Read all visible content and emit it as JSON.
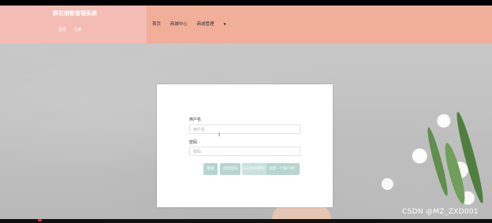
{
  "site": {
    "title": "鲜花销售管理系统",
    "login_label": "登录",
    "register_label": "注册"
  },
  "nav": {
    "items": [
      {
        "label": "首页"
      },
      {
        "label": "商城中心"
      },
      {
        "label": "商城管理"
      }
    ]
  },
  "login": {
    "username_label": "用户名",
    "username_placeholder": "用户名",
    "password_label": "密码",
    "password_placeholder": "密码",
    "login_button": "登录",
    "reset_button": "找回密码",
    "forgot_password": "忘记你的密码？",
    "create_account": "创建一个账户吧！"
  },
  "watermark": "CSDN @MZ_ZXD001",
  "colors": {
    "header_left": "#f3bcb4",
    "header_right": "#f1ae99",
    "button": "#b5d6d0"
  }
}
